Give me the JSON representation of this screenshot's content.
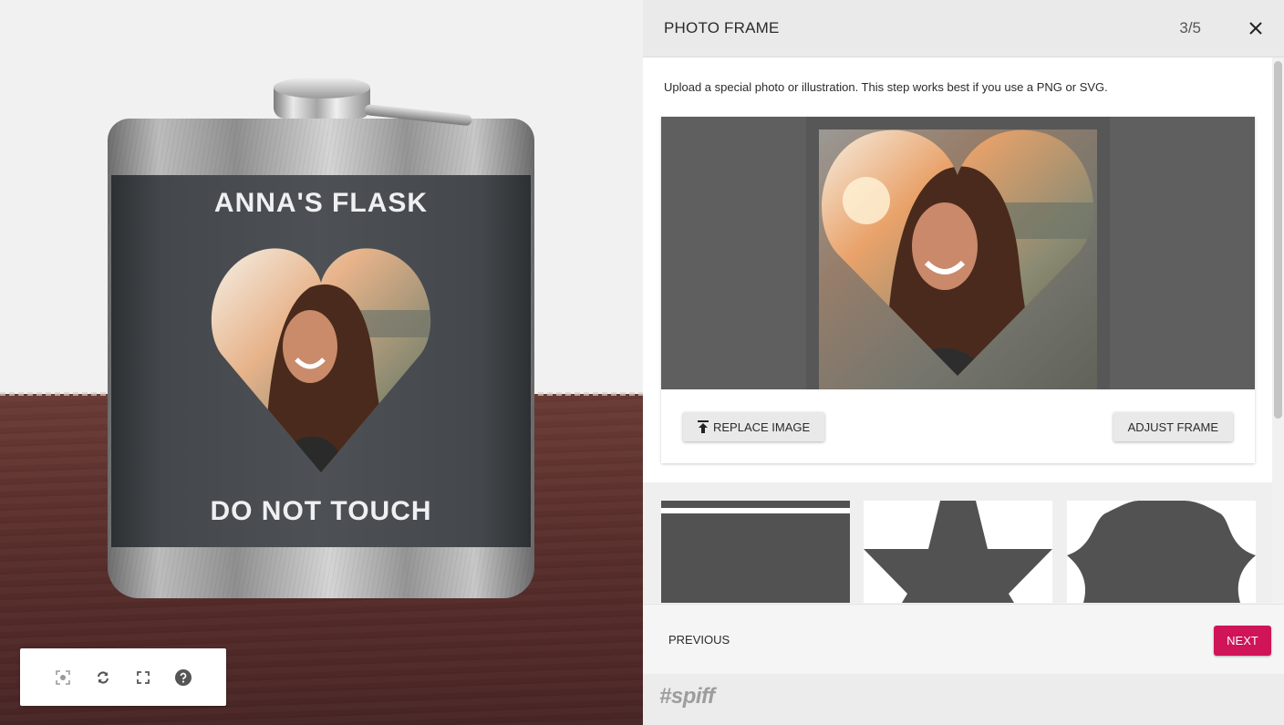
{
  "viewer": {
    "flask_title_top": "ANNA'S FLASK",
    "flask_title_bottom": "DO NOT TOUCH",
    "tools": [
      {
        "name": "recenter-icon"
      },
      {
        "name": "rotate-icon"
      },
      {
        "name": "fullscreen-icon"
      },
      {
        "name": "help-icon"
      }
    ]
  },
  "panel": {
    "title": "PHOTO FRAME",
    "step": "3/5",
    "description": "Upload a special photo or illustration. This step works best if you use a PNG or SVG.",
    "replace_label": "REPLACE IMAGE",
    "adjust_label": "ADJUST FRAME",
    "frames": [
      {
        "shape": "square"
      },
      {
        "shape": "star"
      },
      {
        "shape": "scallop"
      }
    ]
  },
  "footer": {
    "previous_label": "PREVIOUS",
    "next_label": "NEXT"
  },
  "brand": {
    "name": "#spiff"
  },
  "colors": {
    "accent": "#cf1458",
    "label": "#4d5155",
    "frame_fill": "#525252"
  }
}
